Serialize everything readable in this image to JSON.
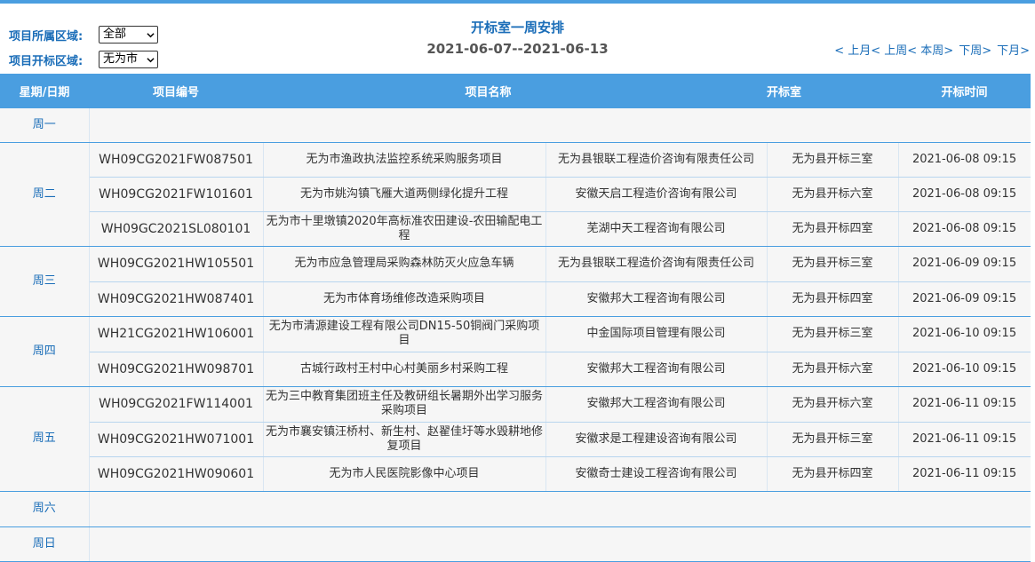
{
  "filters": {
    "region_label": "项目所属区域:",
    "region_value": "全部",
    "open_region_label": "项目开标区域:",
    "open_region_value": "无为市"
  },
  "header": {
    "title": "开标室一周安排",
    "date_range": "2021-06-07--2021-06-13"
  },
  "nav": {
    "prev_month": "< 上月",
    "prev_week": "< 上周",
    "this_week": "< 本周>",
    "next_week": "下周>",
    "next_month": "下月>"
  },
  "table": {
    "columns": [
      "星期/日期",
      "项目编号",
      "项目名称",
      "开标室",
      "开标时间"
    ],
    "days": {
      "mon": "周一",
      "tue": "周二",
      "wed": "周三",
      "thu": "周四",
      "fri": "周五",
      "sat": "周六",
      "sun": "周日"
    },
    "rows": [
      {
        "code": "WH09CG2021FW087501",
        "name": "无为市渔政执法监控系统采购服务项目",
        "agency": "无为县银联工程造价咨询有限责任公司",
        "room": "无为县开标三室",
        "time": "2021-06-08 09:15"
      },
      {
        "code": "WH09CG2021FW101601",
        "name": "无为市姚沟镇飞雁大道两侧绿化提升工程",
        "agency": "安徽天启工程造价咨询有限公司",
        "room": "无为县开标六室",
        "time": "2021-06-08 09:15"
      },
      {
        "code": "WH09GC2021SL080101",
        "name": "无为市十里墩镇2020年高标准农田建设-农田输配电工程",
        "agency": "芜湖中天工程咨询有限公司",
        "room": "无为县开标四室",
        "time": "2021-06-08 09:15"
      },
      {
        "code": "WH09CG2021HW105501",
        "name": "无为市应急管理局采购森林防灭火应急车辆",
        "agency": "无为县银联工程造价咨询有限责任公司",
        "room": "无为县开标三室",
        "time": "2021-06-09 09:15"
      },
      {
        "code": "WH09CG2021HW087401",
        "name": "无为市体育场维修改造采购项目",
        "agency": "安徽邦大工程咨询有限公司",
        "room": "无为县开标四室",
        "time": "2021-06-09 09:15"
      },
      {
        "code": "WH21CG2021HW106001",
        "name": "无为市清源建设工程有限公司DN15-50铜阀门采购项目",
        "agency": "中金国际项目管理有限公司",
        "room": "无为县开标三室",
        "time": "2021-06-10 09:15"
      },
      {
        "code": "WH09CG2021HW098701",
        "name": "古城行政村王村中心村美丽乡村采购工程",
        "agency": "安徽邦大工程咨询有限公司",
        "room": "无为县开标六室",
        "time": "2021-06-10 09:15"
      },
      {
        "code": "WH09CG2021FW114001",
        "name": "无为三中教育集团班主任及教研组长暑期外出学习服务采购项目",
        "agency": "安徽邦大工程咨询有限公司",
        "room": "无为县开标六室",
        "time": "2021-06-11 09:15"
      },
      {
        "code": "WH09CG2021HW071001",
        "name": "无为市襄安镇汪桥村、新生村、赵翟佳圩等水毁耕地修复项目",
        "agency": "安徽求是工程建设咨询有限公司",
        "room": "无为县开标三室",
        "time": "2021-06-11 09:15"
      },
      {
        "code": "WH09CG2021HW090601",
        "name": "无为市人民医院影像中心项目",
        "agency": "安徽奇士建设工程咨询有限公司",
        "room": "无为县开标四室",
        "time": "2021-06-11 09:15"
      }
    ]
  },
  "colors": {
    "accent": "#4a9ee0",
    "title_blue": "#1a6db8"
  }
}
